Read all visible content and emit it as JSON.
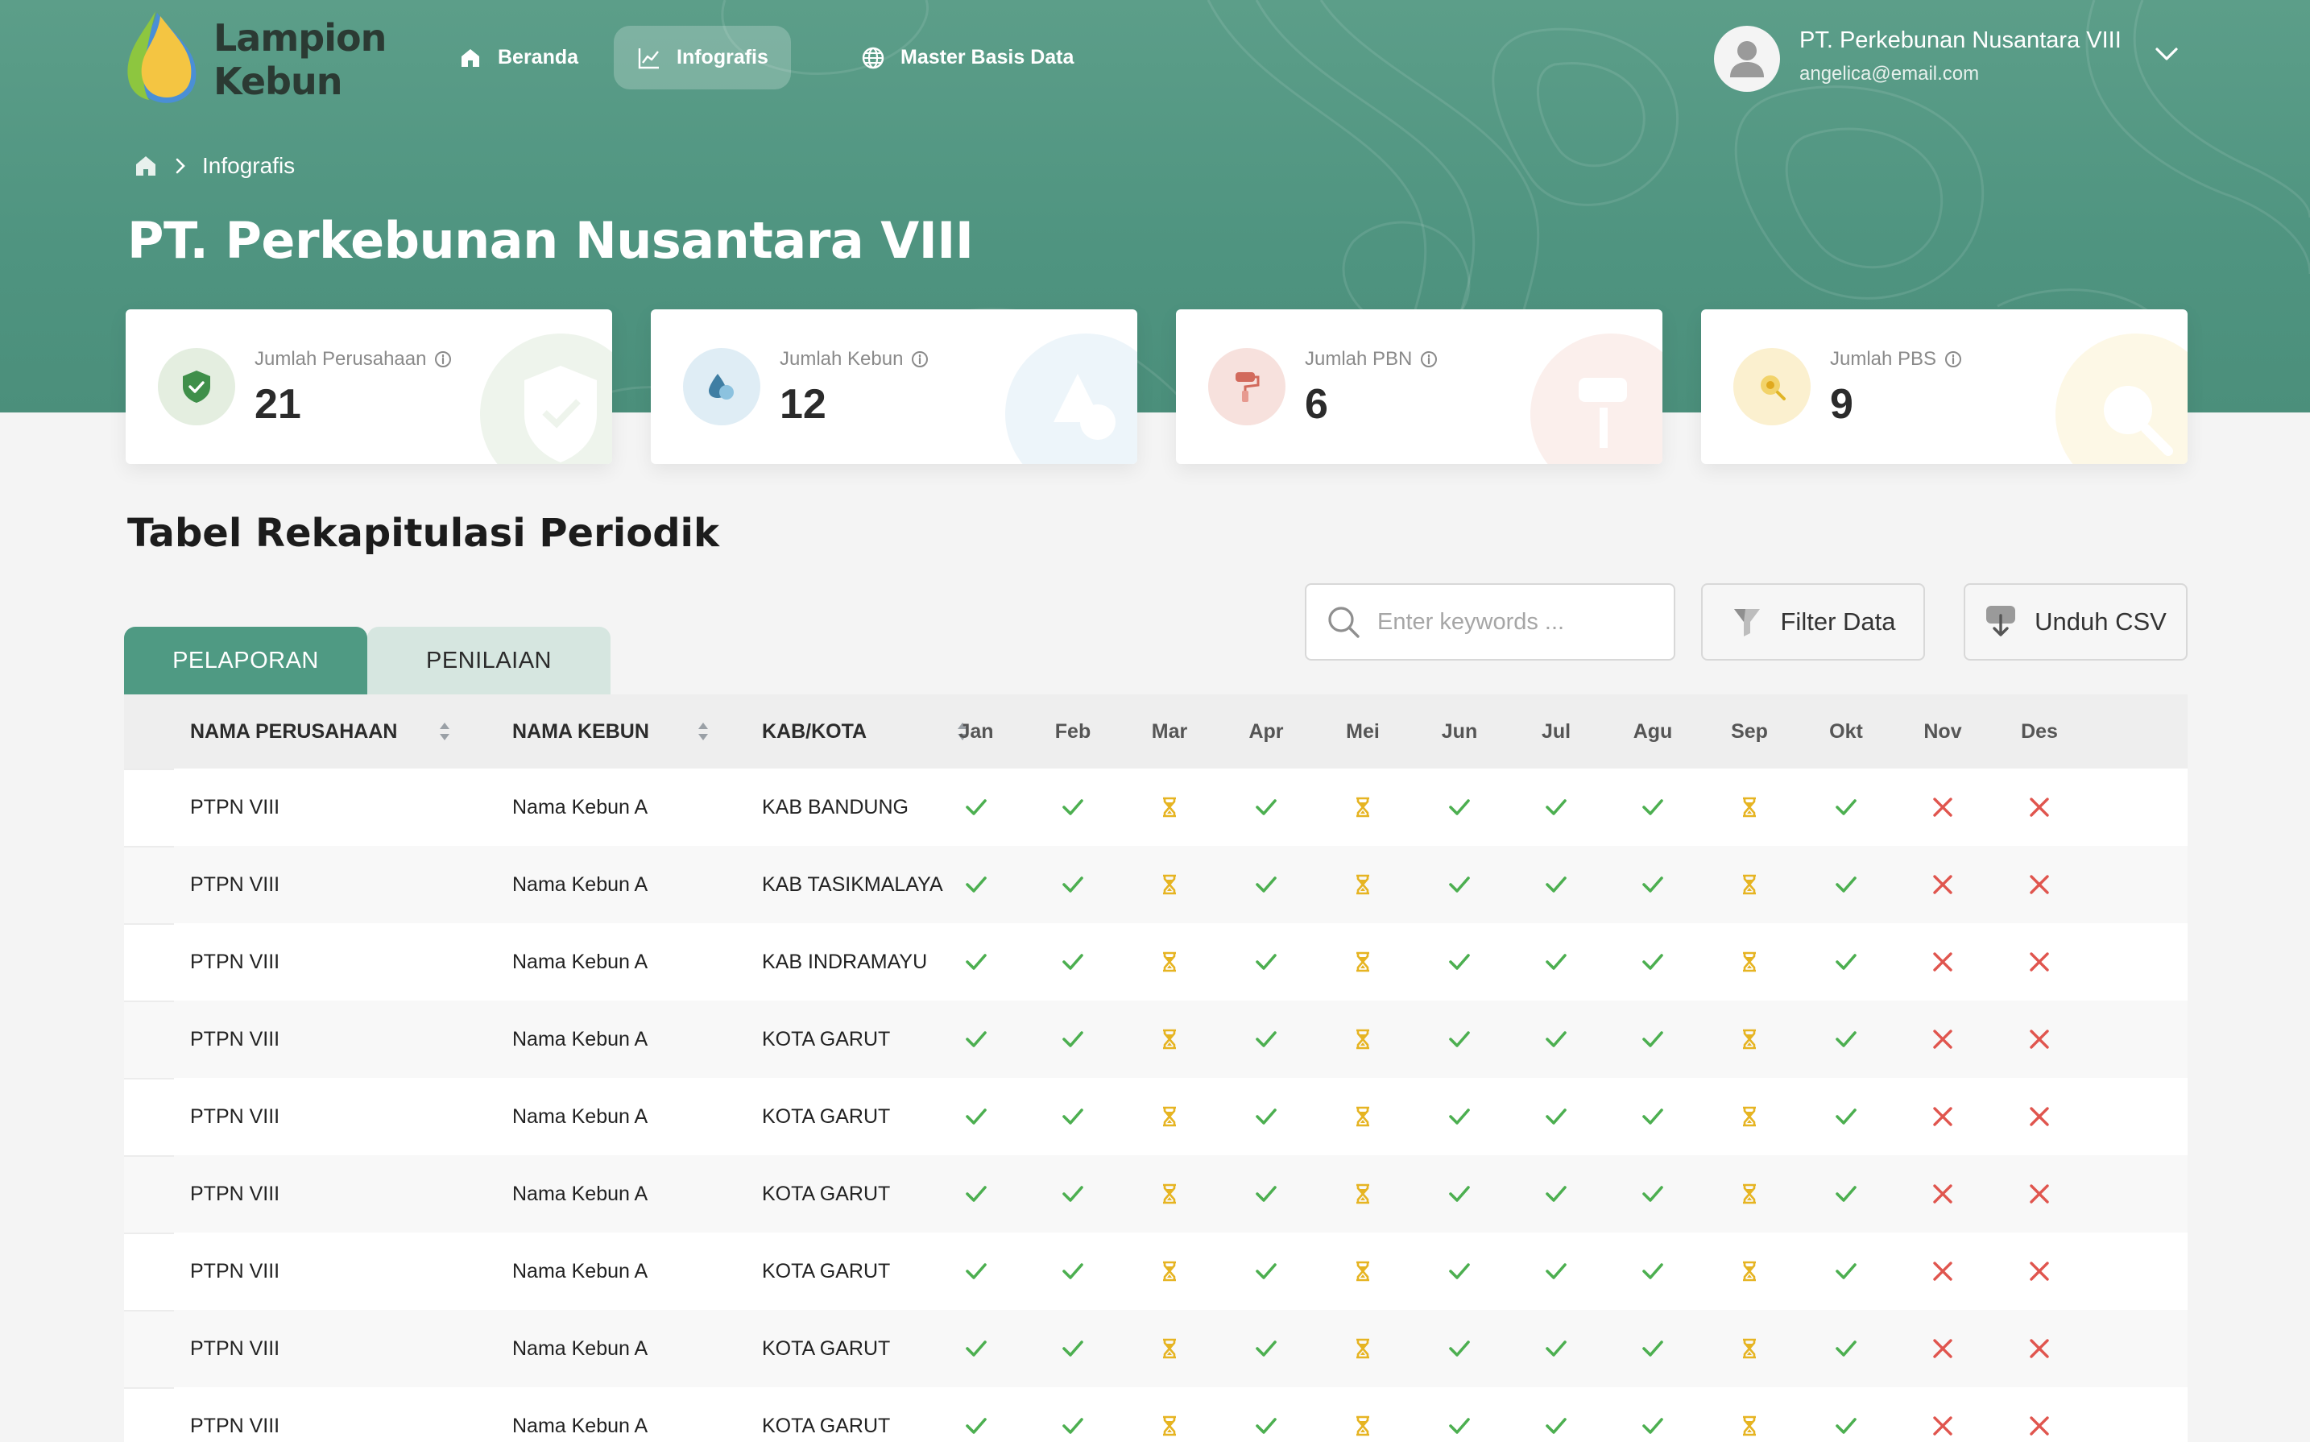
{
  "app": {
    "logo_line1": "Lampion",
    "logo_line2": "Kebun"
  },
  "nav": {
    "items": [
      {
        "label": "Beranda",
        "icon": "home-icon",
        "active": false
      },
      {
        "label": "Infografis",
        "icon": "chart-line-icon",
        "active": true
      },
      {
        "label": "Master Basis Data",
        "icon": "globe-icon",
        "active": false
      }
    ]
  },
  "user": {
    "name": "PT. Perkebunan Nusantara VIII",
    "email": "angelica@email.com"
  },
  "breadcrumb": {
    "current": "Infografis"
  },
  "page": {
    "title": "PT. Perkebunan Nusantara VIII"
  },
  "stats": [
    {
      "label": "Jumlah Perusahaan",
      "value": "21",
      "icon": "shield-check-icon",
      "color": "#3f8f4a",
      "bg": "#e6efe3"
    },
    {
      "label": "Jumlah Kebun",
      "value": "12",
      "icon": "drops-icon",
      "color": "#4a90b8",
      "bg": "#e1eef5"
    },
    {
      "label": "Jumlah PBN",
      "value": "6",
      "icon": "paint-roller-icon",
      "color": "#d9776a",
      "bg": "#f8e3df"
    },
    {
      "label": "Jumlah PBS",
      "value": "9",
      "icon": "search-coin-icon",
      "color": "#e0b526",
      "bg": "#fbf1d3"
    }
  ],
  "section": {
    "title": "Tabel Rekapitulasi Periodik"
  },
  "tabs": [
    {
      "label": "PELAPORAN",
      "active": true
    },
    {
      "label": "PENILAIAN",
      "active": false
    }
  ],
  "toolbar": {
    "search_placeholder": "Enter keywords ...",
    "filter_label": "Filter Data",
    "download_label": "Unduh CSV"
  },
  "table": {
    "columns": {
      "company": "NAMA PERUSAHAAN",
      "garden": "NAMA KEBUN",
      "city": "KAB/KOTA"
    },
    "months": [
      "Jan",
      "Feb",
      "Mar",
      "Apr",
      "Mei",
      "Jun",
      "Jul",
      "Agu",
      "Sep",
      "Okt",
      "Nov",
      "Des"
    ],
    "status_colors": {
      "done": "#4caf50",
      "pending": "#e6b422",
      "missing": "#e0554e"
    },
    "rows": [
      {
        "company": "PTPN VIII",
        "garden": "Nama Kebun A",
        "city": "KAB BANDUNG",
        "status": [
          "done",
          "done",
          "pending",
          "done",
          "pending",
          "done",
          "done",
          "done",
          "pending",
          "done",
          "missing",
          "missing"
        ]
      },
      {
        "company": "PTPN VIII",
        "garden": "Nama Kebun A",
        "city": "KAB TASIKMALAYA",
        "status": [
          "done",
          "done",
          "pending",
          "done",
          "pending",
          "done",
          "done",
          "done",
          "pending",
          "done",
          "missing",
          "missing"
        ]
      },
      {
        "company": "PTPN VIII",
        "garden": "Nama Kebun A",
        "city": "KAB INDRAMAYU",
        "status": [
          "done",
          "done",
          "pending",
          "done",
          "pending",
          "done",
          "done",
          "done",
          "pending",
          "done",
          "missing",
          "missing"
        ]
      },
      {
        "company": "PTPN VIII",
        "garden": "Nama Kebun A",
        "city": "KOTA GARUT",
        "status": [
          "done",
          "done",
          "pending",
          "done",
          "pending",
          "done",
          "done",
          "done",
          "pending",
          "done",
          "missing",
          "missing"
        ]
      },
      {
        "company": "PTPN VIII",
        "garden": "Nama Kebun A",
        "city": "KOTA GARUT",
        "status": [
          "done",
          "done",
          "pending",
          "done",
          "pending",
          "done",
          "done",
          "done",
          "pending",
          "done",
          "missing",
          "missing"
        ]
      },
      {
        "company": "PTPN VIII",
        "garden": "Nama Kebun A",
        "city": "KOTA GARUT",
        "status": [
          "done",
          "done",
          "pending",
          "done",
          "pending",
          "done",
          "done",
          "done",
          "pending",
          "done",
          "missing",
          "missing"
        ]
      },
      {
        "company": "PTPN VIII",
        "garden": "Nama Kebun A",
        "city": "KOTA GARUT",
        "status": [
          "done",
          "done",
          "pending",
          "done",
          "pending",
          "done",
          "done",
          "done",
          "pending",
          "done",
          "missing",
          "missing"
        ]
      },
      {
        "company": "PTPN VIII",
        "garden": "Nama Kebun A",
        "city": "KOTA GARUT",
        "status": [
          "done",
          "done",
          "pending",
          "done",
          "pending",
          "done",
          "done",
          "done",
          "pending",
          "done",
          "missing",
          "missing"
        ]
      },
      {
        "company": "PTPN VIII",
        "garden": "Nama Kebun A",
        "city": "KOTA GARUT",
        "status": [
          "done",
          "done",
          "pending",
          "done",
          "pending",
          "done",
          "done",
          "done",
          "pending",
          "done",
          "missing",
          "missing"
        ]
      }
    ]
  }
}
